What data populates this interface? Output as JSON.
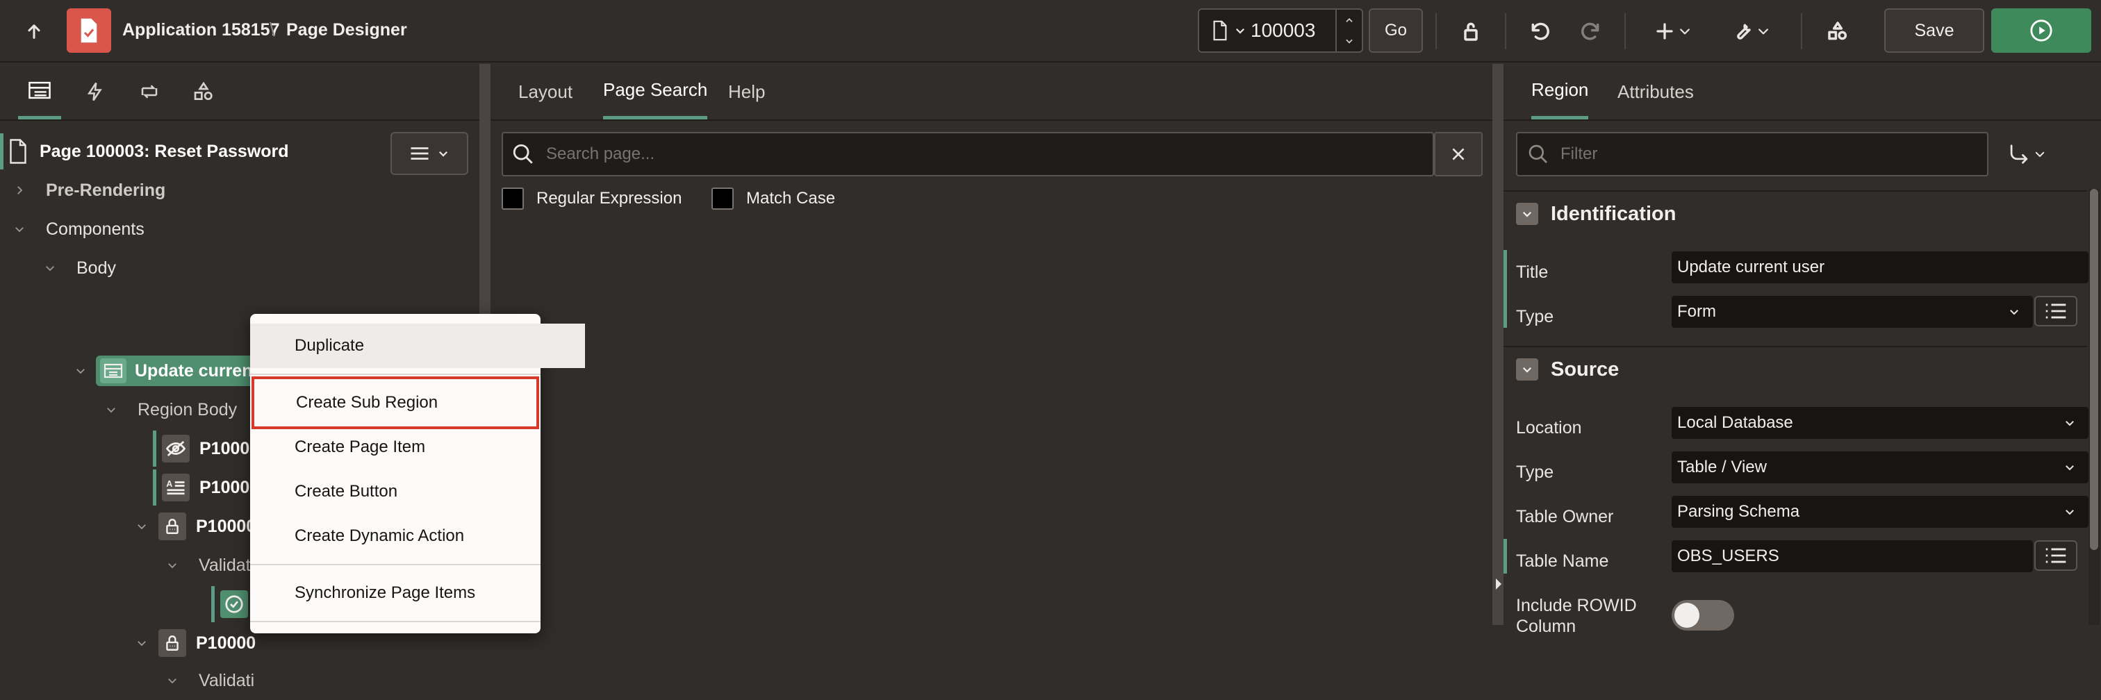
{
  "topbar": {
    "app_title": "Application 158157",
    "separator": "\\",
    "page_title": "Page Designer",
    "page_number": "100003",
    "go_label": "Go",
    "save_label": "Save"
  },
  "left": {
    "page_node": "Page 100003: Reset Password",
    "tree": {
      "pre_rendering": "Pre-Rendering",
      "components": "Components",
      "body": "Body",
      "region": "Update current user",
      "region_body": "Region Body",
      "item1": "P10000",
      "item2": "P10000",
      "item3": "P10000",
      "validations1": "Validat",
      "item4": "P10000",
      "validations2": "Validati"
    }
  },
  "context_menu": {
    "items": [
      "Duplicate",
      "Create Sub Region",
      "Create Page Item",
      "Create Button",
      "Create Dynamic Action",
      "Synchronize Page Items"
    ]
  },
  "center": {
    "tabs": [
      "Layout",
      "Page Search",
      "Help"
    ],
    "search_placeholder": "Search page...",
    "regex_label": "Regular Expression",
    "match_case_label": "Match Case"
  },
  "right": {
    "tabs": [
      "Region",
      "Attributes"
    ],
    "filter_placeholder": "Filter",
    "identification": {
      "heading": "Identification",
      "title_label": "Title",
      "title_value": "Update current user",
      "type_label": "Type",
      "type_value": "Form"
    },
    "source": {
      "heading": "Source",
      "location_label": "Location",
      "location_value": "Local Database",
      "type_label": "Type",
      "type_value": "Table / View",
      "owner_label": "Table Owner",
      "owner_value": "Parsing Schema",
      "table_label": "Table Name",
      "table_value": "OBS_USERS",
      "rowid_label": "Include ROWID",
      "rowid_label2": "Column"
    }
  },
  "colors": {
    "accent_green": "#5c9c86",
    "run_button": "#3f8a5b",
    "app_icon": "#d9574a",
    "highlight_border": "#d63a2a"
  }
}
